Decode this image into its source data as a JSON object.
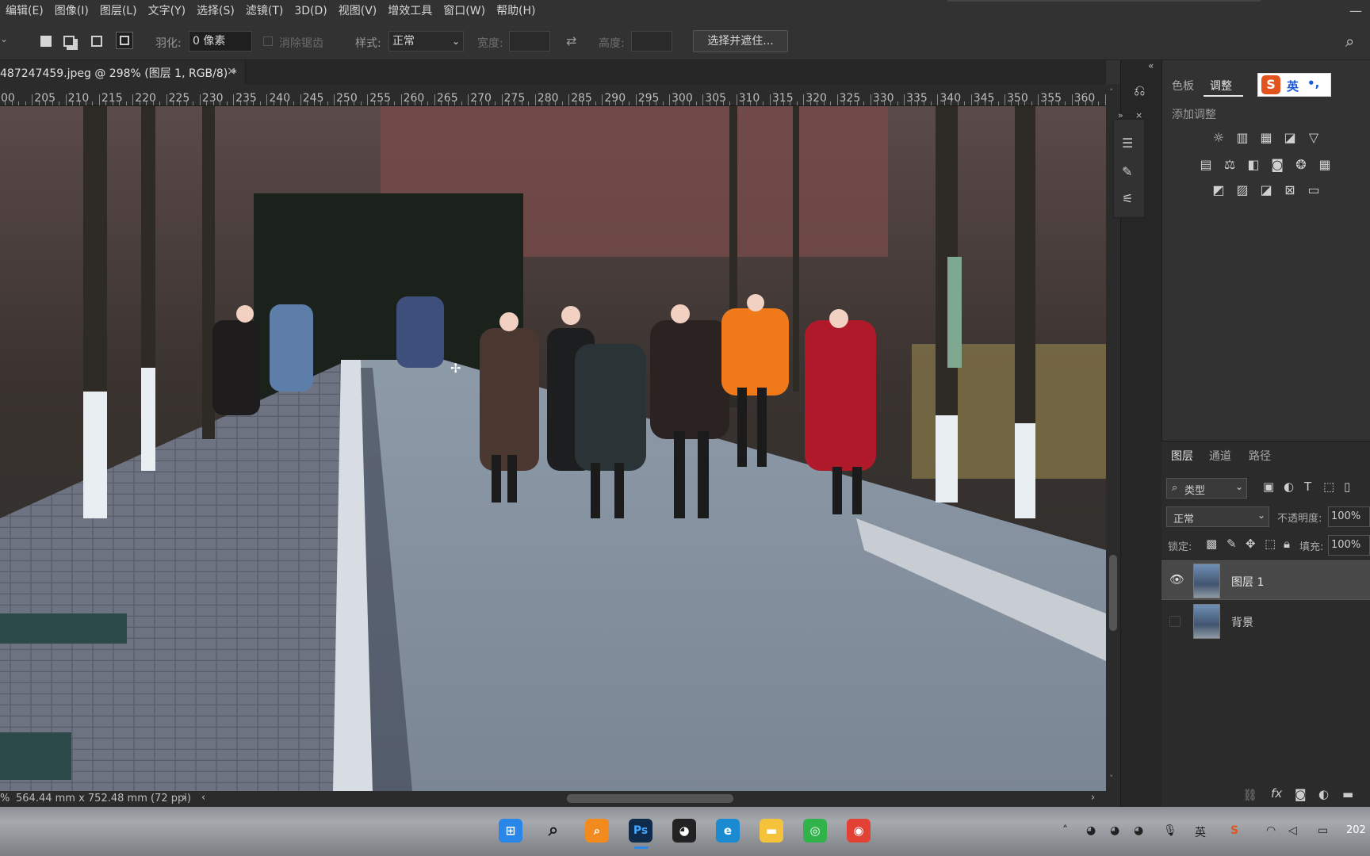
{
  "menu": [
    "编辑(E)",
    "图像(I)",
    "图层(L)",
    "文字(Y)",
    "选择(S)",
    "滤镜(T)",
    "3D(D)",
    "视图(V)",
    "增效工具",
    "窗口(W)",
    "帮助(H)"
  ],
  "options": {
    "feather_label": "羽化:",
    "feather_value": "0 像素",
    "antialias_label": "消除锯齿",
    "style_label": "样式:",
    "style_value": "正常",
    "width_label": "宽度:",
    "height_label": "高度:",
    "select_mask_button": "选择并遮住..."
  },
  "document_tab": {
    "title": "487247459.jpeg @ 298% (图层 1, RGB/8) *",
    "close": "×"
  },
  "ruler_ticks": [
    "00",
    "205",
    "210",
    "215",
    "220",
    "225",
    "230",
    "235",
    "240",
    "245",
    "250",
    "255",
    "260",
    "265",
    "270",
    "275",
    "280",
    "285",
    "290",
    "295",
    "300",
    "305",
    "310",
    "315",
    "320",
    "325",
    "330",
    "335",
    "340",
    "345",
    "350",
    "355",
    "360",
    "3"
  ],
  "status_bar": {
    "zoom": "%",
    "doc_size": "564.44 mm x 752.48 mm (72 ppi)"
  },
  "right_panel": {
    "tabs": [
      "色板",
      "调整"
    ],
    "active_tab": "调整",
    "add_adjustment_label": "添加调整",
    "ime_label": "英",
    "ime_punct": "•,"
  },
  "layers_panel": {
    "tabs": [
      "图层",
      "通道",
      "路径"
    ],
    "active_tab": "图层",
    "filter_kind": "类型",
    "blend_mode": "正常",
    "opacity_label": "不透明度:",
    "opacity_value": "100%",
    "lock_label": "锁定:",
    "fill_label": "填充:",
    "fill_value": "100%",
    "layers": [
      {
        "name": "图层 1",
        "visible": true,
        "selected": true
      },
      {
        "name": "背景",
        "visible": false,
        "selected": false
      }
    ]
  },
  "taskbar": {
    "ps_label": "Ps",
    "tray_lang": "英",
    "clock": "202"
  },
  "colors": {
    "panel_bg": "#323232",
    "canvas_sky": "#a9b8c9",
    "accent_orange": "#f07a1a",
    "accent_red": "#b0192a"
  }
}
